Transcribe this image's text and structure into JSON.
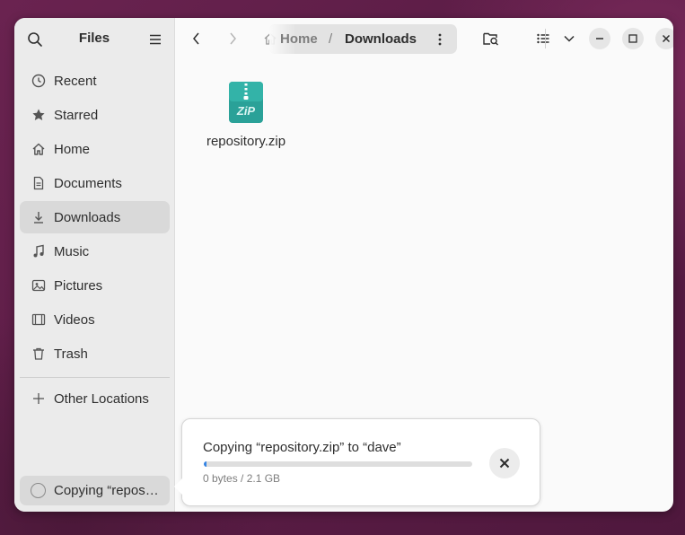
{
  "app": {
    "title": "Files"
  },
  "sidebar": {
    "items": [
      {
        "label": "Recent",
        "icon": "clock-icon"
      },
      {
        "label": "Starred",
        "icon": "star-icon"
      },
      {
        "label": "Home",
        "icon": "home-icon"
      },
      {
        "label": "Documents",
        "icon": "document-icon"
      },
      {
        "label": "Downloads",
        "icon": "download-icon",
        "active": true
      },
      {
        "label": "Music",
        "icon": "music-icon"
      },
      {
        "label": "Pictures",
        "icon": "picture-icon"
      },
      {
        "label": "Videos",
        "icon": "video-icon"
      },
      {
        "label": "Trash",
        "icon": "trash-icon"
      }
    ],
    "other_locations": "Other Locations",
    "status": "Copying “repository.zip” to “dave”"
  },
  "pathbar": {
    "home": "Home",
    "separator": "/",
    "current": "Downloads"
  },
  "files": [
    {
      "name": "repository.zip",
      "icon_text": "ZiP"
    }
  ],
  "operation": {
    "title": "Copying “repository.zip” to “dave”",
    "subtitle": "0 bytes / 2.1 GB",
    "progress": 0.01
  },
  "colors": {
    "accent": "#3584e4",
    "zip": "#2aa198"
  }
}
